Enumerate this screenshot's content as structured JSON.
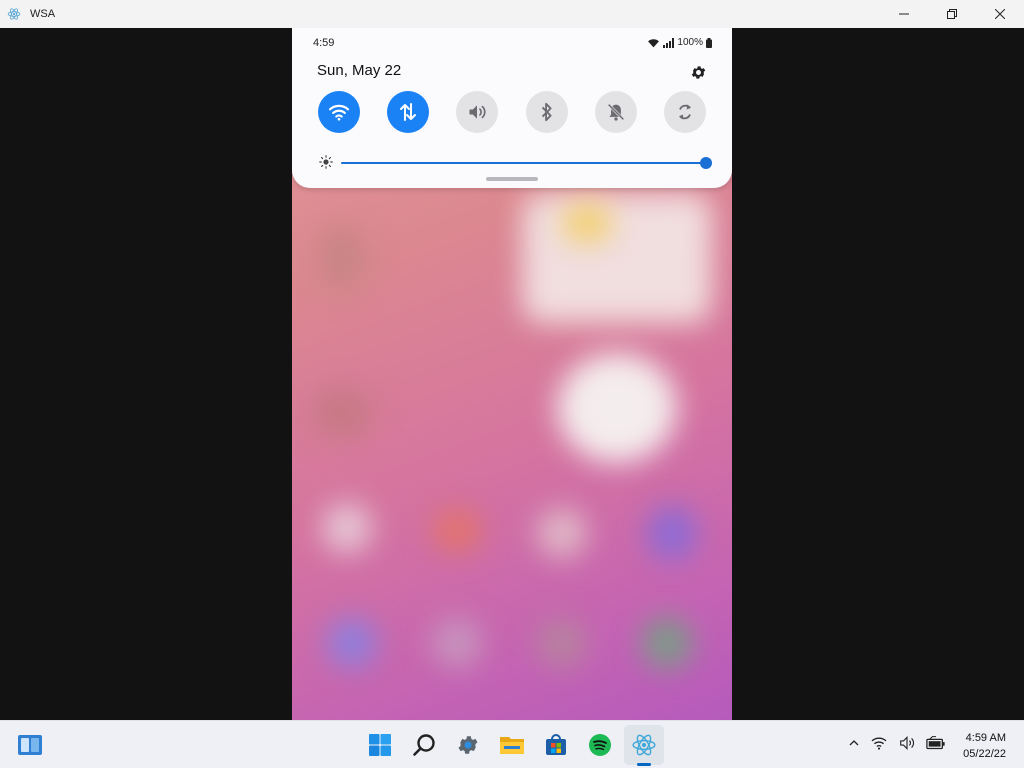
{
  "window": {
    "title": "WSA",
    "icons": {
      "app": "react-icon",
      "minimize": "minimize-icon",
      "maximize": "maximize-icon",
      "close": "close-icon"
    }
  },
  "phone": {
    "status_bar": {
      "time": "4:59",
      "battery": "100%"
    },
    "quick_panel": {
      "date": "Sun, May 22",
      "settings_icon": "gear-icon",
      "toggles": [
        {
          "name": "wifi",
          "icon": "wifi-icon",
          "state": "on"
        },
        {
          "name": "mobile-data",
          "icon": "mobile-data-icon",
          "state": "on"
        },
        {
          "name": "sound",
          "icon": "sound-icon",
          "state": "off"
        },
        {
          "name": "bluetooth",
          "icon": "bluetooth-icon",
          "state": "off"
        },
        {
          "name": "do-not-disturb",
          "icon": "bell-off-icon",
          "state": "off"
        },
        {
          "name": "auto-rotate",
          "icon": "rotate-icon",
          "state": "off"
        }
      ],
      "brightness_level": 1.0
    }
  },
  "taskbar": {
    "items": [
      "widgets-icon",
      "start-icon",
      "search-icon",
      "settings-icon",
      "file-explorer-icon",
      "store-icon",
      "spotify-icon",
      "wsa-icon"
    ],
    "active_item": "wsa-icon",
    "tray_icons": [
      "chevron-up-icon",
      "wifi-icon",
      "volume-icon",
      "battery-icon"
    ],
    "clock": {
      "time": "4:59 AM",
      "date": "05/22/22"
    }
  },
  "colors": {
    "accent": "#1a82f5",
    "slider": "#1a6fd4",
    "taskbar_accent": "#0067c0"
  }
}
